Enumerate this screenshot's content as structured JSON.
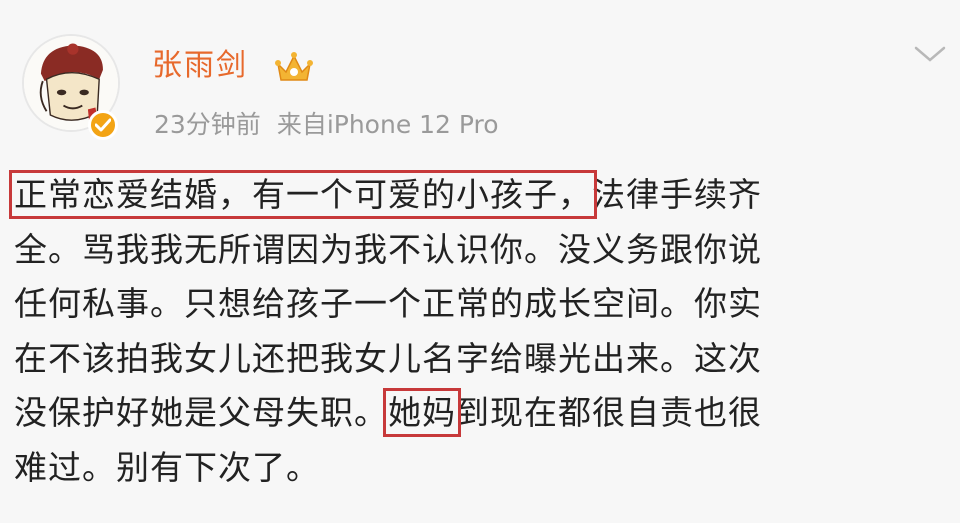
{
  "user": {
    "name": "张雨剑",
    "verified_color": "#f3a415",
    "name_color": "#e7692c"
  },
  "post": {
    "time": "23分钟前",
    "source": "来自iPhone 12 Pro",
    "lines": [
      {
        "highlight": "正常恋爱结婚，有一个可爱的小孩子，",
        "rest": "法律手续齐"
      },
      {
        "text": "全。骂我我无所谓因为我不认识你。没义务跟你说"
      },
      {
        "text": "任何私事。只想给孩子一个正常的成长空间。你实"
      },
      {
        "text": "在不该拍我女儿还把我女儿名字给曝光出来。这次"
      },
      {
        "before": "没保护好她是父母失职。",
        "highlight": "她妈",
        "after": "到现在都很自责也很"
      },
      {
        "text": "难过。别有下次了。"
      }
    ],
    "highlight_color": "#c7393a"
  },
  "icons": {
    "avatar": "cartoon-avatar",
    "verified": "verified-badge-icon",
    "crown": "crown-icon",
    "dropdown": "chevron-down-icon"
  }
}
